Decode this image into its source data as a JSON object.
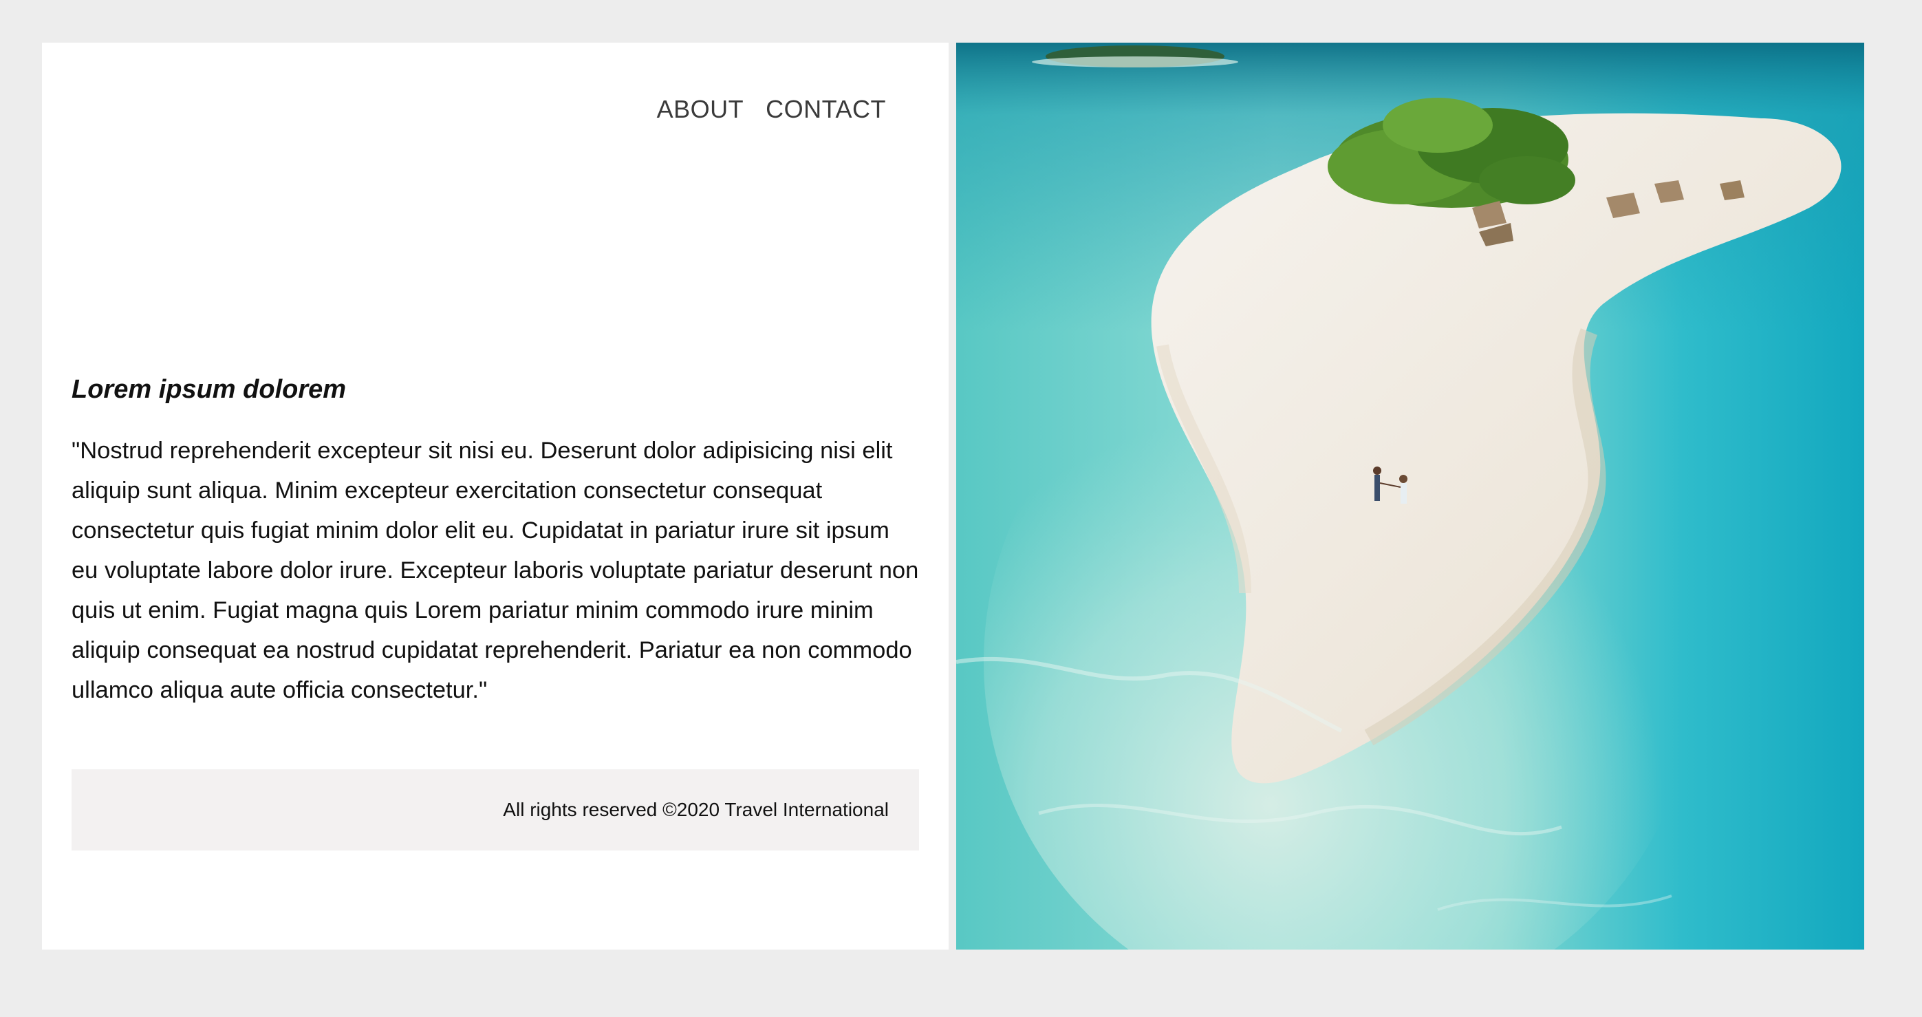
{
  "nav": {
    "about_label": "ABOUT",
    "contact_label": "CONTACT"
  },
  "main": {
    "heading": "Lorem ipsum dolorem",
    "paragraph": "\"Nostrud reprehenderit excepteur sit nisi eu. Deserunt dolor adipisicing nisi elit aliquip sunt aliqua. Minim excepteur exercitation consectetur consequat consectetur quis fugiat minim dolor elit eu. Cupidatat in pariatur irure sit ipsum eu voluptate labore dolor irure. Excepteur laboris voluptate pariatur deserunt non quis ut enim. Fugiat magna quis Lorem pariatur minim commodo irure minim aliquip consequat ea nostrud cupidatat reprehenderit. Pariatur ea non commodo ullamco aliqua aute officia consectetur.\""
  },
  "footer": {
    "copyright": "All rights reserved ©2020 Travel International"
  },
  "photo": {
    "icon": "beach-island-photo"
  },
  "colors": {
    "page_background": "#ededed",
    "card_background": "#ffffff",
    "footer_background": "#f3f1f1",
    "nav_text": "#3a3a3a",
    "body_text": "#111111",
    "sea_light": "#8fdcd6",
    "sea_deep": "#16a9c0",
    "sand": "#f1ece3",
    "foliage": "#4f8a2a"
  }
}
